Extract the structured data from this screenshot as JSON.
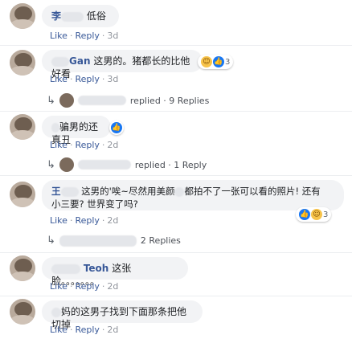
{
  "comments": [
    {
      "name": "李",
      "text": "低俗",
      "like": "Like",
      "reply": "Reply",
      "time": "3d"
    },
    {
      "name": "Gan",
      "text": "这男的。猪都长的比他好看",
      "like": "Like",
      "reply": "Reply",
      "time": "3d",
      "reaction_count": "3"
    },
    {
      "name": "",
      "text": "骗男的还真丑",
      "like": "Like",
      "reply": "Reply",
      "time": "2d",
      "reaction_count": ""
    },
    {
      "name": "王",
      "text_line1": "这男的'唉~尽然用美颜",
      "text_line1b": "都拍不了一张可以看的照片! 还有",
      "text_line2": "小三要? 世界变了吗?",
      "like": "Like",
      "reply": "Reply",
      "time": "2d",
      "reaction_count": "3"
    },
    {
      "name": "Teoh",
      "text": "这张脸。。。。。。。",
      "like": "Like",
      "reply": "Reply",
      "time": "2d"
    },
    {
      "name": "",
      "text": "妈的这男子找到下面那条把他切掉",
      "like": "Like",
      "reply": "Reply",
      "time": "2d"
    }
  ],
  "reply_threads": [
    {
      "text": "replied · 9 Replies"
    },
    {
      "text": "replied · 1 Reply"
    },
    {
      "text": "2 Replies"
    }
  ],
  "icons": {
    "like": "like-icon",
    "haha": "haha-icon",
    "reply_arrow": "reply-arrow-icon"
  },
  "colors": {
    "link": "#385898",
    "bubble": "#f2f3f5",
    "like_blue": "#1877f2",
    "haha_yellow": "#f7c34a"
  }
}
